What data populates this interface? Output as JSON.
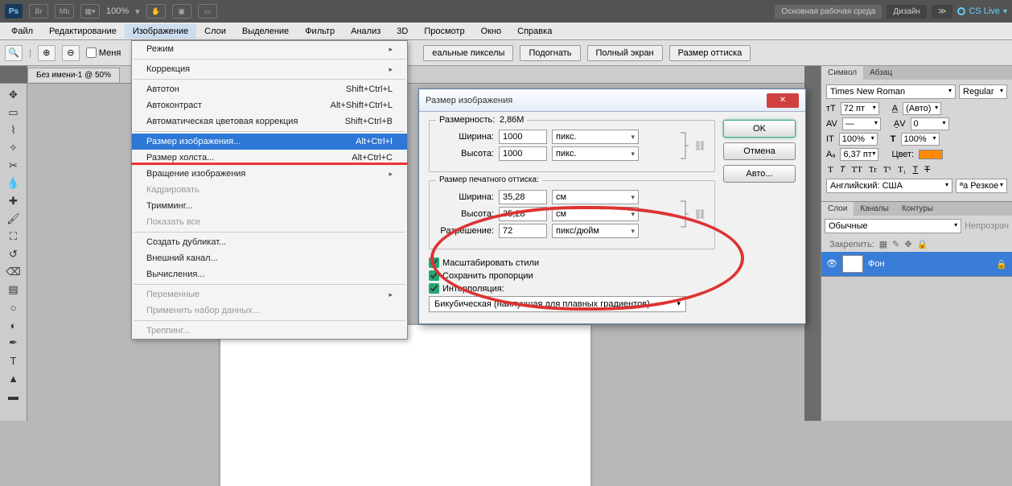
{
  "appbar": {
    "zoom": "100%",
    "workspace_main": "Основная рабочая среда",
    "workspace_design": "Дизайн",
    "cslive": "CS Live"
  },
  "menubar": [
    "Файл",
    "Редактирование",
    "Изображение",
    "Слои",
    "Выделение",
    "Фильтр",
    "Анализ",
    "3D",
    "Просмотр",
    "Окно",
    "Справка"
  ],
  "optbar": {
    "chk_label": "Меня",
    "btn1": "еальные пикселы",
    "btn2": "Подогнать",
    "btn3": "Полный экран",
    "btn4": "Размер оттиска"
  },
  "doc_tab": "Без имени-1 @ 50%",
  "dropdown": {
    "mode": "Режим",
    "correction": "Коррекция",
    "autotone": "Автотон",
    "sc_autotone": "Shift+Ctrl+L",
    "autocontrast": "Автоконтраст",
    "sc_autocontrast": "Alt+Shift+Ctrl+L",
    "autocolor": "Автоматическая цветовая коррекция",
    "sc_autocolor": "Shift+Ctrl+B",
    "imgsize": "Размер изображения...",
    "sc_imgsize": "Alt+Ctrl+I",
    "canvassize": "Размер холста...",
    "sc_canvassize": "Alt+Ctrl+C",
    "rotate": "Вращение изображения",
    "crop": "Кадрировать",
    "trim": "Тримминг...",
    "reveal": "Показать все",
    "dup": "Создать дубликат...",
    "extchan": "Внешний канал...",
    "calc": "Вычисления...",
    "vars": "Переменные",
    "applyds": "Применить набор данных...",
    "trap": "Треппинг..."
  },
  "dialog": {
    "title": "Размер изображения",
    "ok": "OK",
    "cancel": "Отмена",
    "auto": "Авто...",
    "dim_legend": "Размерность:",
    "dim_val": "2,86M",
    "w_lbl": "Ширина:",
    "w_val": "1000",
    "h_lbl": "Высота:",
    "h_val": "1000",
    "px_unit": "пикс.",
    "print_legend": "Размер печатного оттиска:",
    "pw_val": "35,28",
    "ph_val": "35,28",
    "cm_unit": "см",
    "res_lbl": "Разрешение:",
    "res_val": "72",
    "res_unit": "пикс/дюйм",
    "scale_styles": "Масштабировать стили",
    "keep_ratio": "Сохранить пропорции",
    "interp_lbl": "Интерполяция:",
    "interp_val": "Бикубическая (наилучшая для плавных градиентов)"
  },
  "char_panel": {
    "tab_symbol": "Символ",
    "tab_para": "Абзац",
    "font": "Times New Roman",
    "style": "Regular",
    "size": "72 пт",
    "leading": "(Авто)",
    "tracking": "0",
    "vscale": "100%",
    "hscale": "100%",
    "baseline": "6,37 пт",
    "color_lbl": "Цвет:",
    "lang": "Английский: США",
    "aa": "Резкое"
  },
  "layers_panel": {
    "tab_layers": "Слои",
    "tab_channels": "Каналы",
    "tab_paths": "Контуры",
    "blend": "Обычные",
    "opacity_lbl": "Непрозрач",
    "lock_lbl": "Закрепить:",
    "layer_name": "Фон"
  }
}
